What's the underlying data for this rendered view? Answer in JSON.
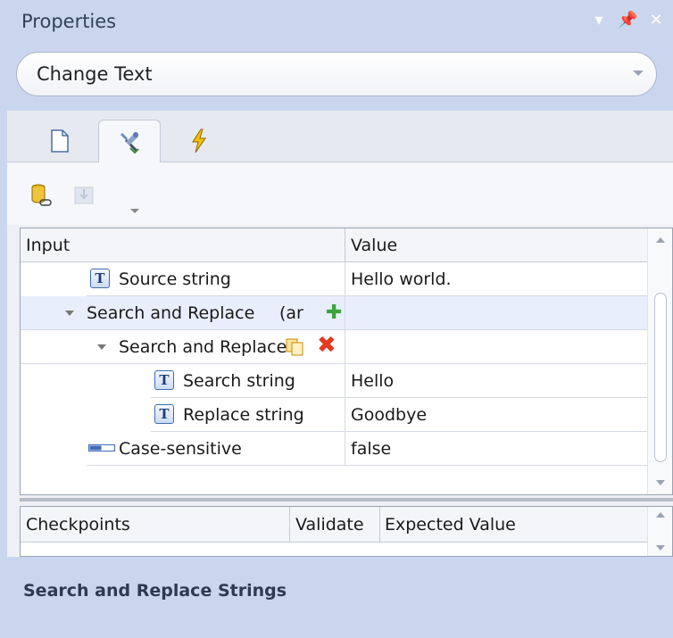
{
  "panel": {
    "title": "Properties"
  },
  "combo": {
    "selected": "Change Text"
  },
  "tabs": [
    {
      "icon": "page-icon"
    },
    {
      "icon": "tools-icon"
    },
    {
      "icon": "lightning-icon"
    }
  ],
  "toolbar": {
    "icons": [
      "database-link-icon",
      "download-icon"
    ]
  },
  "grid": {
    "headers": {
      "input": "Input",
      "value": "Value"
    },
    "rows": [
      {
        "label": "Source string",
        "value": "Hello world.",
        "icon": "text-icon"
      },
      {
        "label": "Search and Replace",
        "extra": "(ar",
        "value": ""
      },
      {
        "label": "Search and Replace",
        "value": ""
      },
      {
        "label": "Search string",
        "value": "Hello",
        "icon": "text-icon"
      },
      {
        "label": "Replace string",
        "value": "Goodbye",
        "icon": "text-icon"
      },
      {
        "label": "Case-sensitive",
        "value": "false",
        "icon": "boolean-icon"
      }
    ]
  },
  "checkpoints": {
    "headers": {
      "name": "Checkpoints",
      "validate": "Validate",
      "expected": "Expected Value"
    }
  },
  "description": {
    "text": "Search and Replace Strings"
  },
  "colors": {
    "accent": "#c9d6ee",
    "delete": "#e23b1f",
    "add": "#3aa43a"
  }
}
